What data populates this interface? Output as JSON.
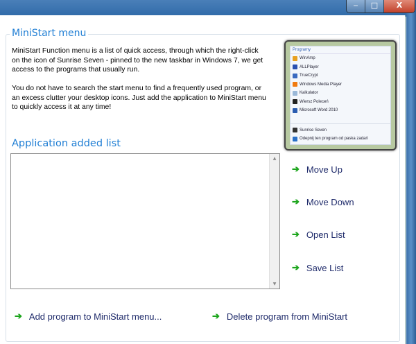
{
  "window": {
    "minimize": "‒",
    "maximize": "□",
    "close": "X"
  },
  "group_title": "MiniStart menu",
  "description": [
    "MiniStart Function menu is a list of quick access, through which the right-click on the icon of Sunrise Seven - pinned to the new taskbar in Windows 7, we get access to the programs that usually run.",
    "You do not have to search the start menu to find a frequently used program, or an excess clutter your desktop icons. Just add the application to MiniStart menu to quickly access it at any time!"
  ],
  "preview": {
    "header": "Programy",
    "items": [
      {
        "label": "WinAmp",
        "color": "#e8a020"
      },
      {
        "label": "ALLPlayer",
        "color": "#2a50b0"
      },
      {
        "label": "TrueCrypt",
        "color": "#3a6ac0"
      },
      {
        "label": "Windows Media Player",
        "color": "#f07a10"
      },
      {
        "label": "Kalkulator",
        "color": "#9ab8d8"
      },
      {
        "label": "Wiersz Poleceń",
        "color": "#222222"
      },
      {
        "label": "Microsoft Word 2010",
        "color": "#2a5cb0"
      }
    ],
    "footer": [
      {
        "label": "Sunrise Seven",
        "color": "#333333"
      },
      {
        "label": "Odepnij ten program od paska zadań",
        "color": "#2a70c8"
      }
    ]
  },
  "list_title": "Application added list",
  "list_items": [],
  "actions": {
    "move_up": "Move Up",
    "move_down": "Move Down",
    "open_list": "Open List",
    "save_list": "Save List",
    "add": "Add program to MiniStart menu...",
    "delete": "Delete program from MiniStart"
  },
  "arrow": "➔"
}
